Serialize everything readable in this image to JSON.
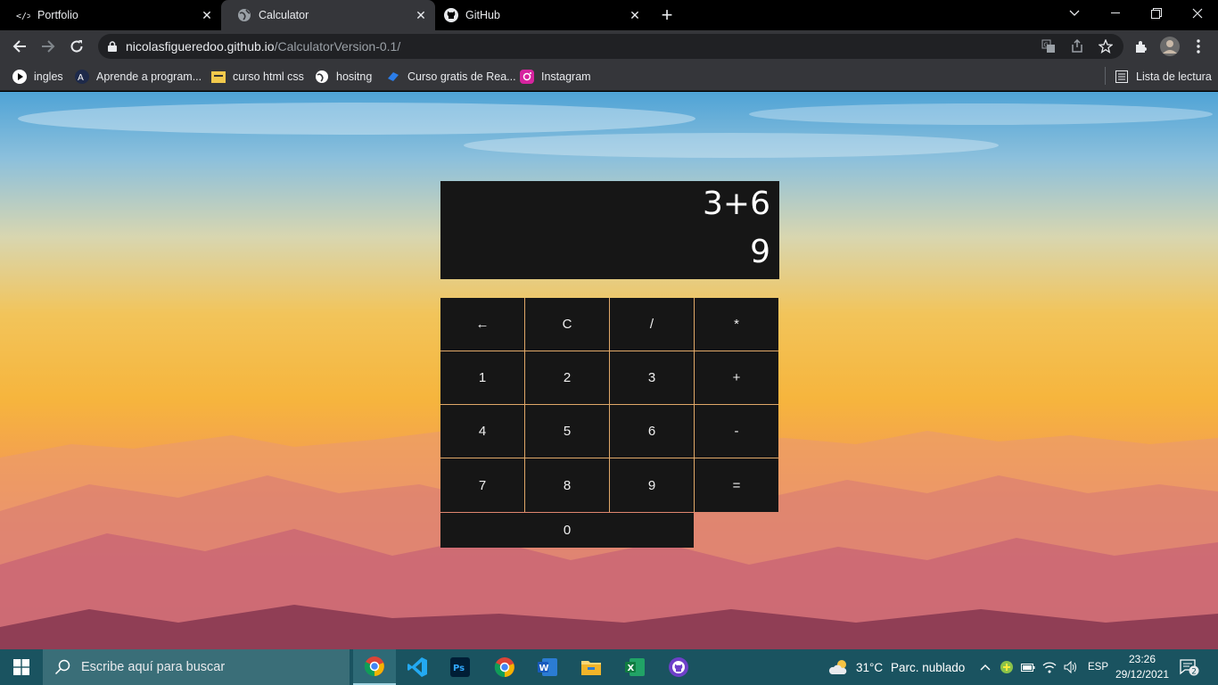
{
  "browser": {
    "tabs": [
      {
        "title": "Portfolio",
        "favicon": "code-icon"
      },
      {
        "title": "Calculator",
        "favicon": "globe-icon"
      },
      {
        "title": "GitHub",
        "favicon": "github-icon"
      }
    ],
    "url_host": "nicolasfigueredoo.github.io",
    "url_path": "/CalculatorVersion-0.1/",
    "bookmarks": [
      {
        "label": "ingles"
      },
      {
        "label": "Aprende a program..."
      },
      {
        "label": "curso html css"
      },
      {
        "label": "hositng"
      },
      {
        "label": "Curso gratis de Rea..."
      },
      {
        "label": "Instagram"
      }
    ],
    "reading_list": "Lista de lectura"
  },
  "calculator": {
    "expression": "3+6",
    "result": "9",
    "keys": [
      "←",
      "C",
      "/",
      "*",
      "1",
      "2",
      "3",
      "+",
      "4",
      "5",
      "6",
      "-",
      "7",
      "8",
      "9",
      "=",
      "0"
    ]
  },
  "taskbar": {
    "search_placeholder": "Escribe aquí para buscar",
    "weather_temp": "31°C",
    "weather_text": "Parc. nublado",
    "language": "ESP",
    "time": "23:26",
    "date": "29/12/2021",
    "notification_count": "2"
  },
  "colors": {
    "calc_bg": "#161616",
    "key_border": "#e0a868",
    "taskbar": "#1a5360"
  }
}
